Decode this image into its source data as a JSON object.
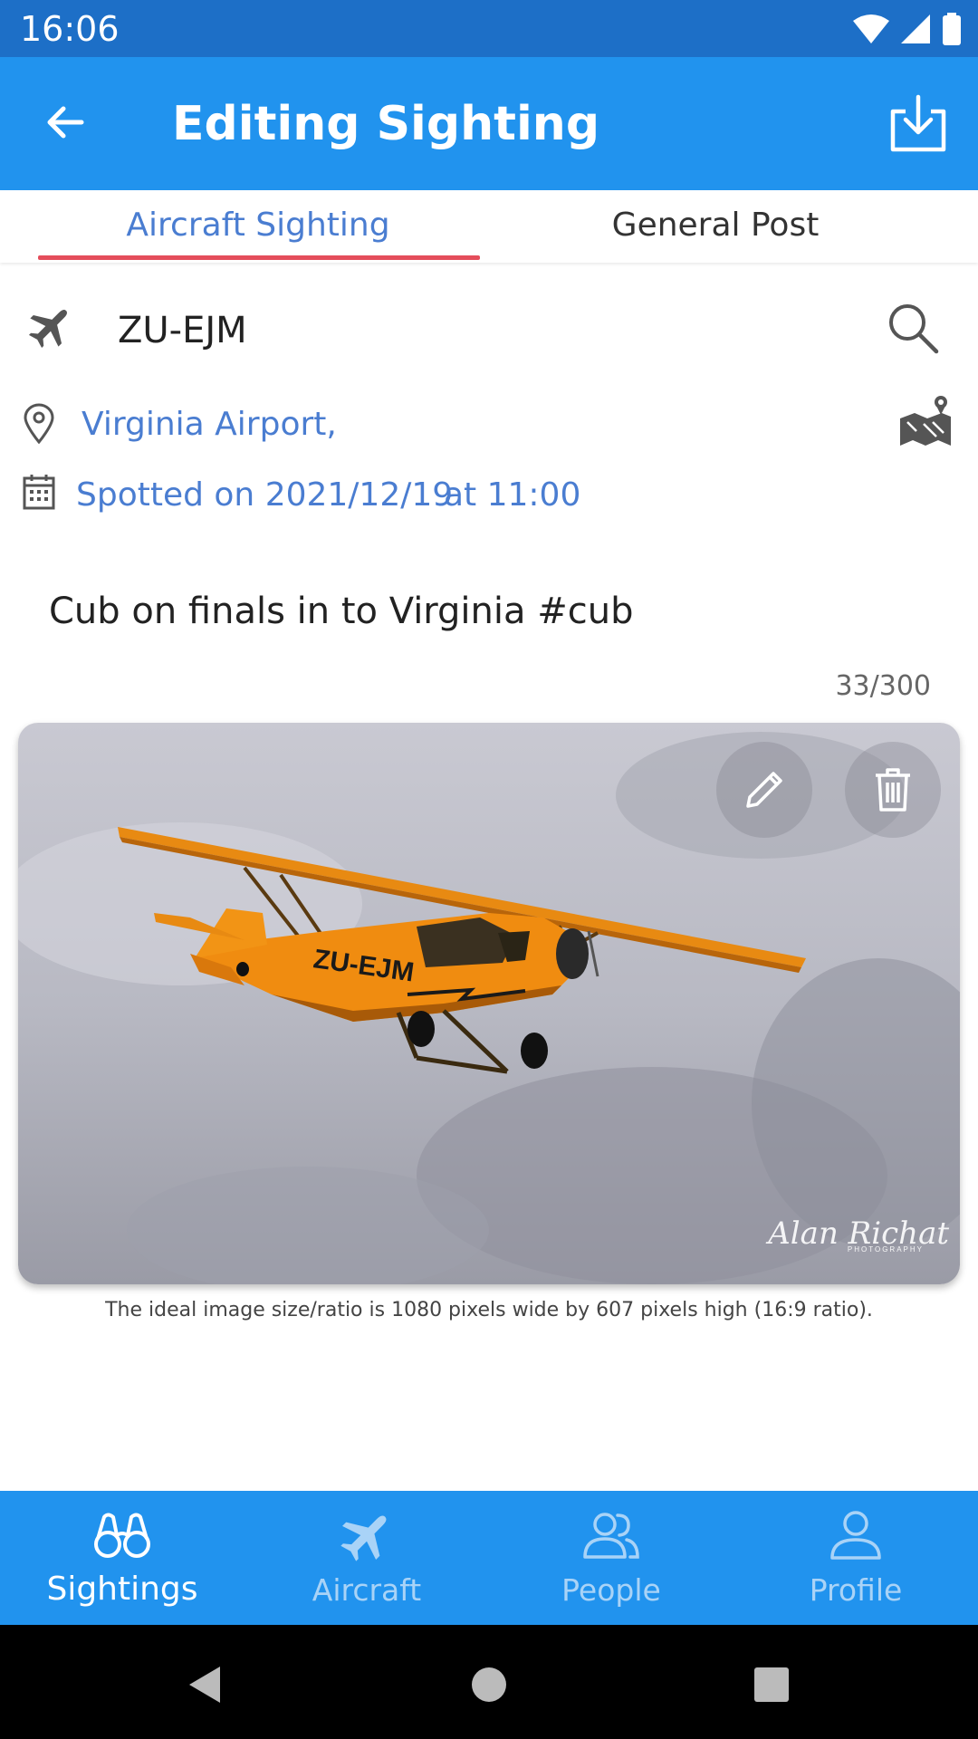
{
  "status_bar": {
    "time": "16:06"
  },
  "app_bar": {
    "title": "Editing Sighting"
  },
  "tabs": [
    {
      "label": "Aircraft Sighting",
      "active": true
    },
    {
      "label": "General Post",
      "active": false
    }
  ],
  "sighting": {
    "registration": "ZU-EJM",
    "location": "Virginia Airport,",
    "date_text": "Spotted on 2021/12/19",
    "time_text": "at 11:00",
    "caption": "Cub on finals in to Virginia #cub",
    "char_count": "33/300"
  },
  "photo": {
    "aircraft_marking": "ZU-EJM",
    "watermark": "Alan Richat",
    "watermark_sub": "PHOTOGRAPHY"
  },
  "hint": "The ideal image size/ratio is 1080 pixels wide by 607 pixels high (16:9 ratio).",
  "bottom_nav": [
    {
      "label": "Sightings",
      "icon": "binoculars-icon",
      "active": true
    },
    {
      "label": "Aircraft",
      "icon": "airplane-icon",
      "active": false
    },
    {
      "label": "People",
      "icon": "people-icon",
      "active": false
    },
    {
      "label": "Profile",
      "icon": "person-icon",
      "active": false
    }
  ],
  "colors": {
    "app_bar": "#2193ee",
    "status_bar": "#1d6fc7",
    "accent_text": "#4a7dd1",
    "tab_indicator": "#e44d5b",
    "aircraft_body": "#f08c10"
  }
}
